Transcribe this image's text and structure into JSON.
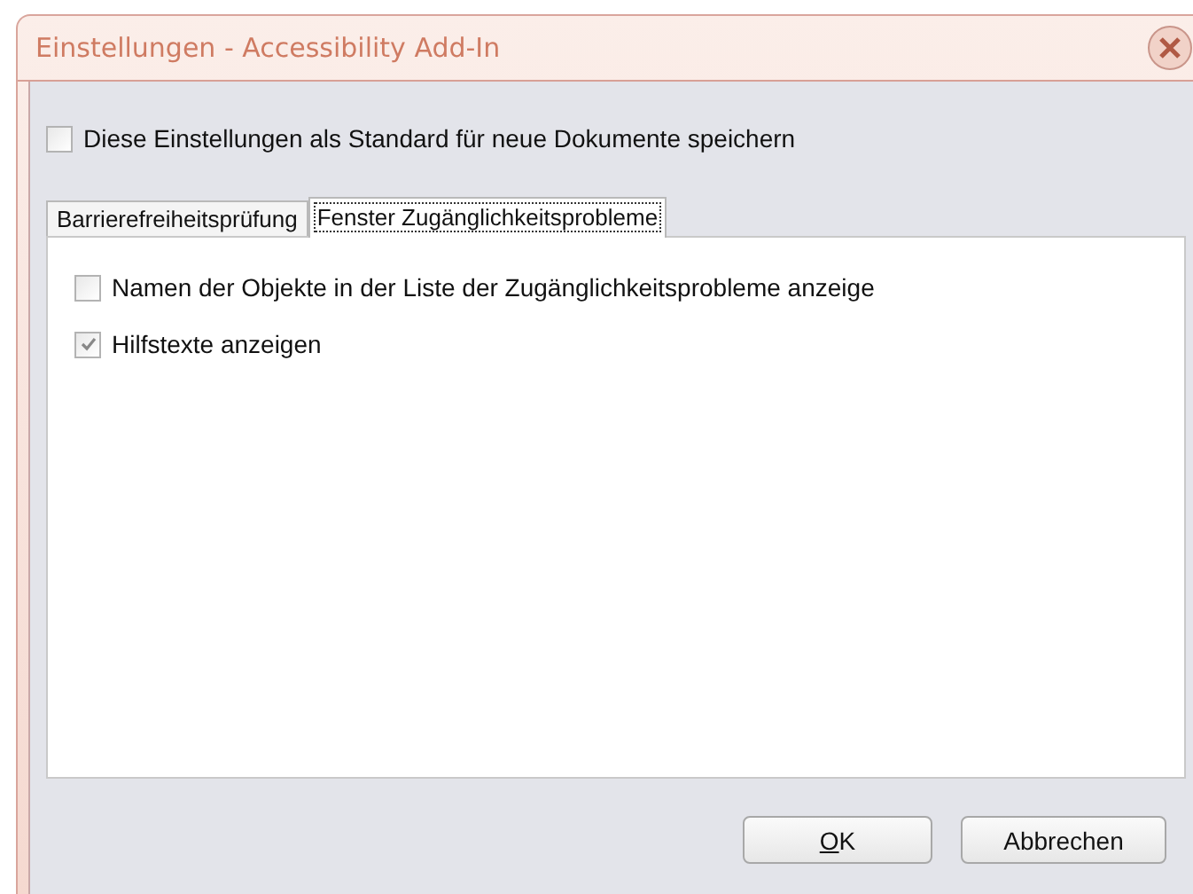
{
  "window": {
    "title": "Einstellungen - Accessibility Add-In"
  },
  "default_checkbox": {
    "label": "Diese Einstellungen als Standard für neue Dokumente speichern",
    "checked": false
  },
  "tabs": [
    {
      "label": "Barrierefreiheitsprüfung",
      "selected": false
    },
    {
      "label": "Fenster Zugänglichkeitsprobleme",
      "selected": true
    }
  ],
  "options": [
    {
      "label": "Namen der Objekte in der Liste der Zugänglichkeitsprobleme anzeige",
      "checked": false
    },
    {
      "label": "Hilfstexte anzeigen",
      "checked": true
    }
  ],
  "buttons": [
    {
      "label": "OK",
      "mnemonic": true
    },
    {
      "label": "Abbrechen",
      "mnemonic": false
    }
  ]
}
